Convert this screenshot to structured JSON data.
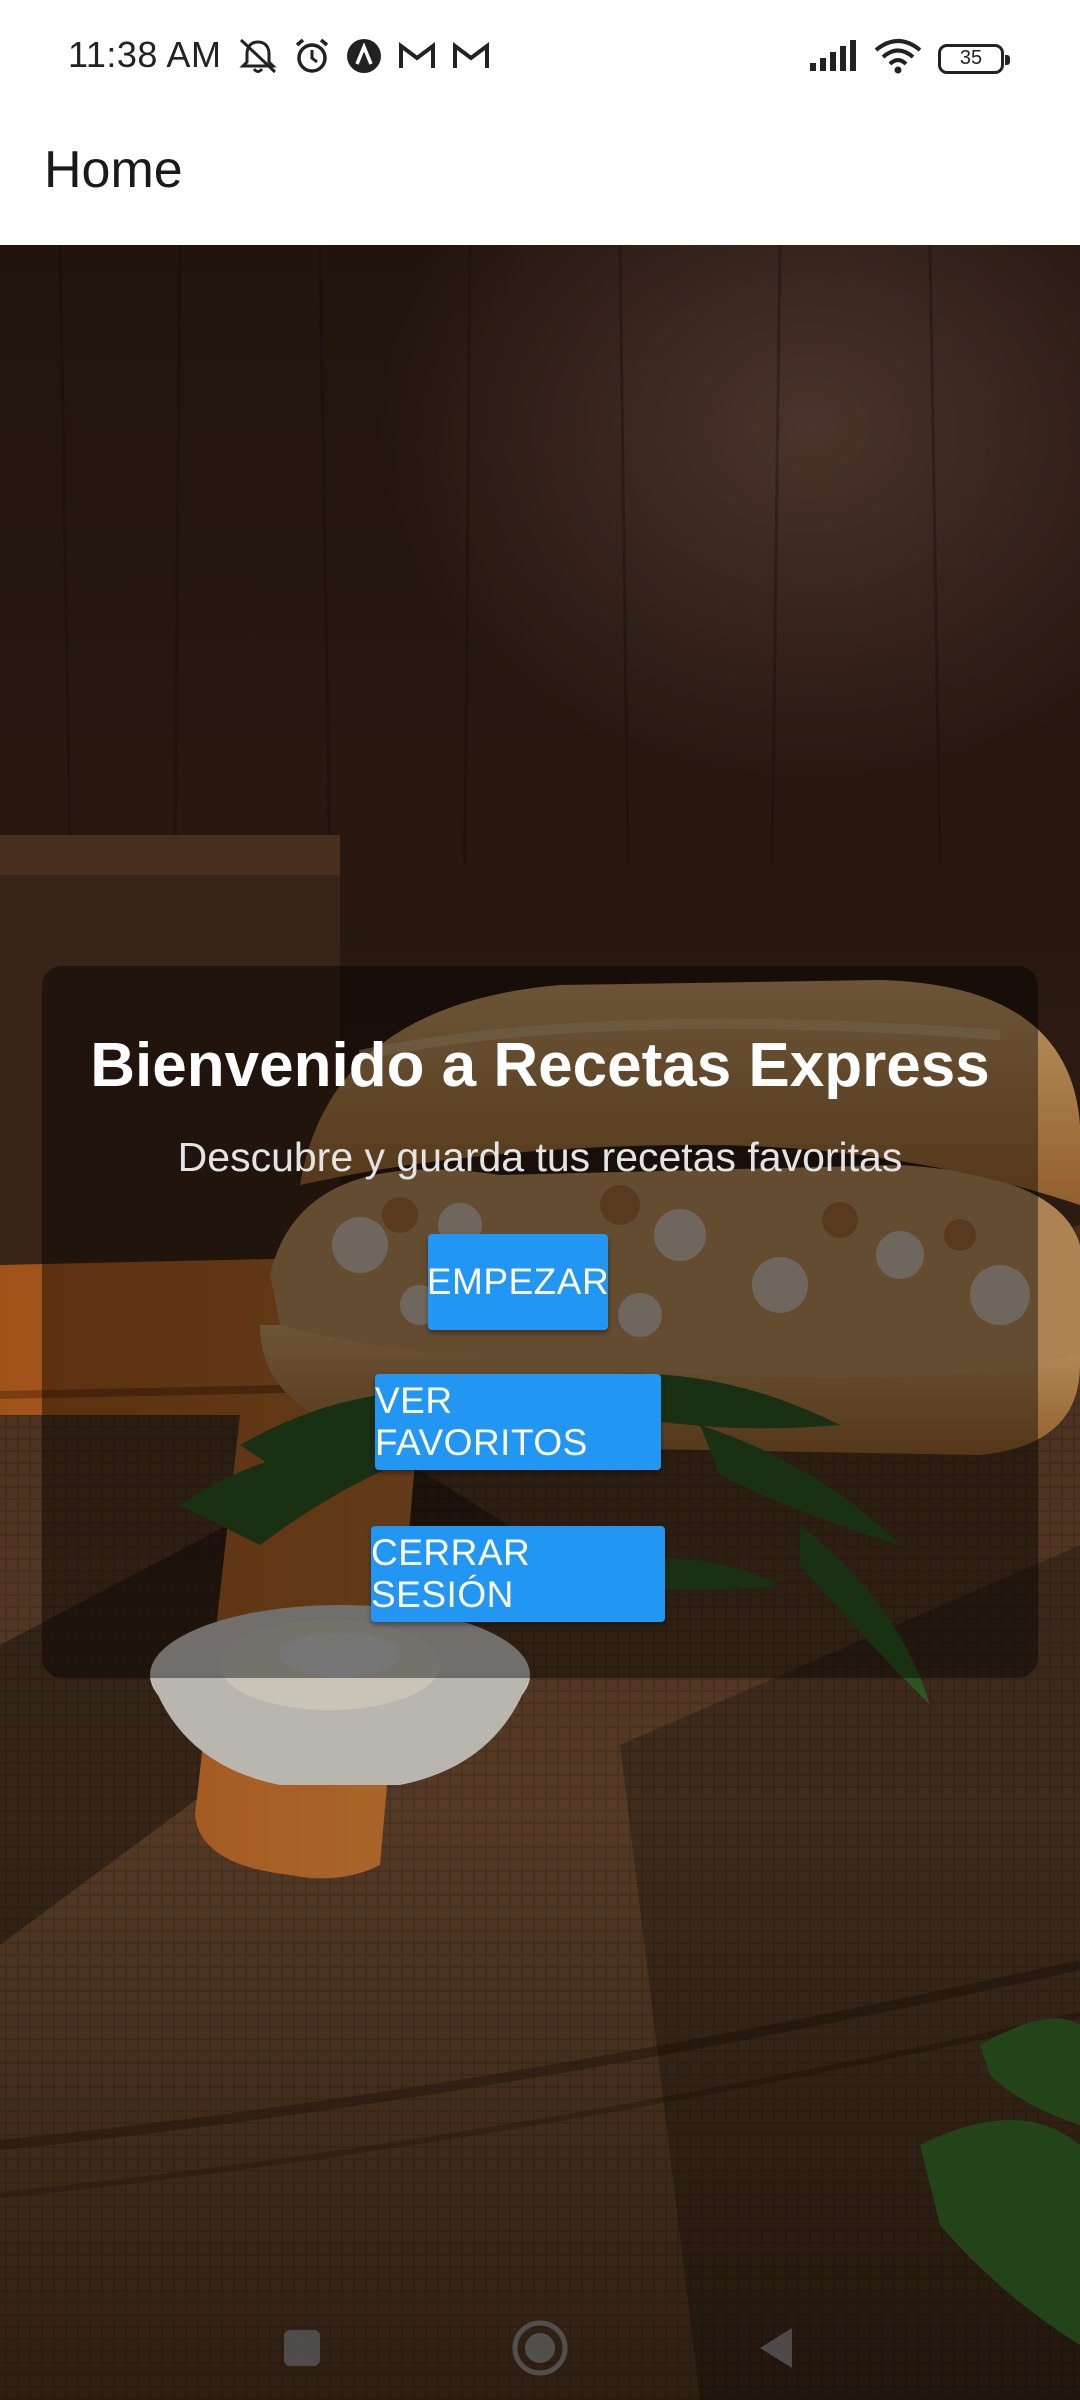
{
  "status_bar": {
    "time": "11:38 AM",
    "battery": "35",
    "left_icons": [
      "notification-off-icon",
      "alarm-icon",
      "app-icon",
      "gmail-icon",
      "gmail-icon"
    ],
    "right_icons": [
      "signal-icon",
      "wifi-icon",
      "battery-icon"
    ]
  },
  "app_bar": {
    "title": "Home"
  },
  "card": {
    "title": "Bienvenido a Recetas Express",
    "subtitle": "Descubre y guarda tus recetas favoritas",
    "buttons": {
      "start": "EMPEZAR",
      "favorites": "VER FAVORITOS",
      "logout": "CERRAR SESIÓN"
    }
  },
  "nav_bar": {
    "icons": [
      "recents-icon",
      "home-icon",
      "back-icon"
    ]
  },
  "colors": {
    "button": "#2196f3",
    "overlay": "rgba(0,0,0,0.42)",
    "status_bar_bg": "#ffffff",
    "app_bar_bg": "#ffffff"
  }
}
